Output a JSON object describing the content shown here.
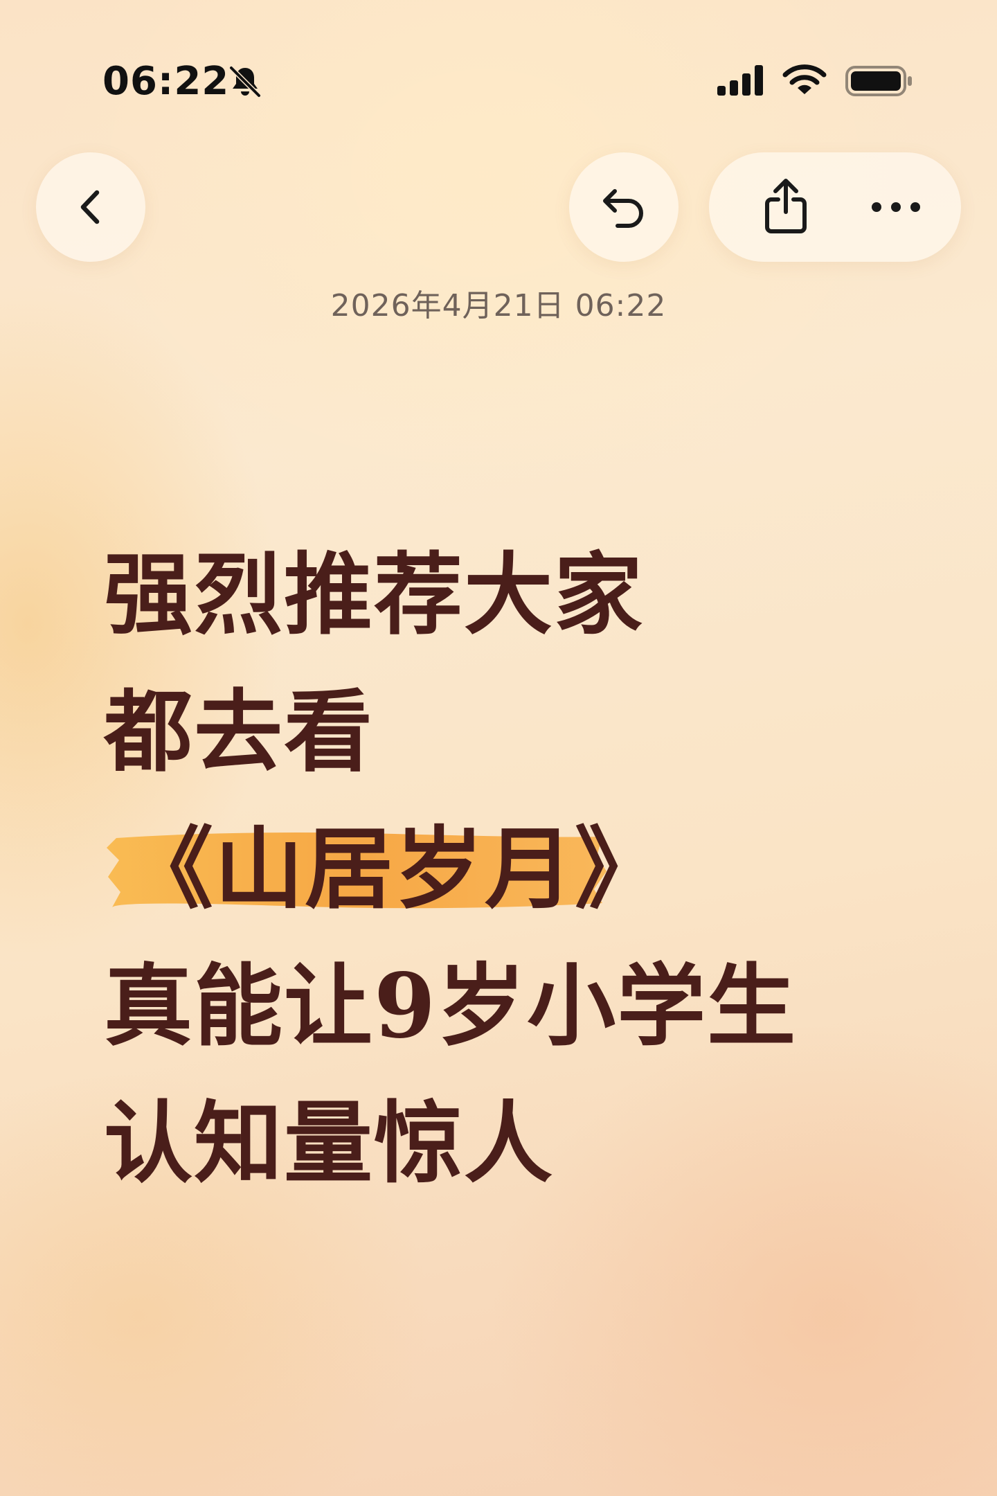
{
  "status_bar": {
    "time": "06:22",
    "icons": [
      "bell-slash-icon",
      "cellular-signal-icon",
      "wifi-icon",
      "battery-icon"
    ]
  },
  "nav": {
    "icons": [
      "chevron-left-icon",
      "undo-icon",
      "share-icon",
      "more-icon"
    ]
  },
  "note": {
    "timestamp": "2026年4月21日 06:22",
    "lines": [
      "强烈推荐大家",
      "都去看",
      "《山居岁月》",
      "真能让9岁小学生",
      "认知量惊人"
    ]
  },
  "colors": {
    "text": "#4a1e1a",
    "highlight": "#f6a33a",
    "background": "#fbe6cb"
  }
}
